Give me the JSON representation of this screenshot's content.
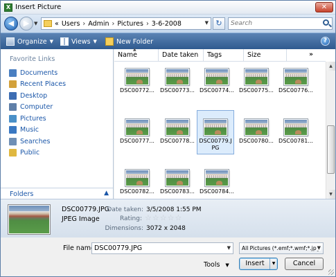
{
  "window": {
    "title": "Insert Picture",
    "close_label": "✕"
  },
  "address": {
    "crumb_prefix": "«",
    "crumbs": [
      "Users",
      "Admin",
      "Pictures",
      "3-6-2008"
    ],
    "search_placeholder": "Search"
  },
  "toolbar": {
    "organize_label": "Organize",
    "views_label": "Views",
    "new_folder_label": "New Folder"
  },
  "nav": {
    "heading": "Favorite Links",
    "items": [
      {
        "label": "Documents",
        "color": "#4a7fc1"
      },
      {
        "label": "Recent Places",
        "color": "#d3a13a"
      },
      {
        "label": "Desktop",
        "color": "#3d6db3"
      },
      {
        "label": "Computer",
        "color": "#5f7fa8"
      },
      {
        "label": "Pictures",
        "color": "#4a90c8"
      },
      {
        "label": "Music",
        "color": "#3a78c2"
      },
      {
        "label": "Searches",
        "color": "#6f8fb5"
      },
      {
        "label": "Public",
        "color": "#e0b840"
      }
    ],
    "folders_label": "Folders"
  },
  "columns": {
    "name": "Name",
    "date_taken": "Date taken",
    "tags": "Tags",
    "size": "Size",
    "more": "»"
  },
  "files": [
    {
      "name": "DSC00772...",
      "selected": false
    },
    {
      "name": "DSC00773...",
      "selected": false
    },
    {
      "name": "DSC00774...",
      "selected": false
    },
    {
      "name": "DSC00775...",
      "selected": false
    },
    {
      "name": "DSC00776...",
      "selected": false
    },
    {
      "name": "DSC00777...",
      "selected": false
    },
    {
      "name": "DSC00778...",
      "selected": false
    },
    {
      "name": "DSC00779.JPG",
      "selected": true
    },
    {
      "name": "DSC00780...",
      "selected": false
    },
    {
      "name": "DSC00781...",
      "selected": false
    },
    {
      "name": "DSC00782...",
      "selected": false
    },
    {
      "name": "DSC00783...",
      "selected": false
    },
    {
      "name": "DSC00784...",
      "selected": false
    }
  ],
  "details": {
    "file_name": "DSC00779.JPG",
    "file_type": "JPEG Image",
    "date_taken_label": "Date taken:",
    "date_taken_value": "3/5/2008 1:55 PM",
    "rating_label": "Rating:",
    "rating_value": 0,
    "rating_max": 5,
    "dimensions_label": "Dimensions:",
    "dimensions_value": "3072 x 2048"
  },
  "footer": {
    "file_name_label": "File name:",
    "file_name_value": "DSC00779.JPG",
    "filter_value": "All Pictures (*.emf;*.wmf;*.jpg;",
    "tools_label": "Tools",
    "insert_label": "Insert",
    "cancel_label": "Cancel"
  }
}
